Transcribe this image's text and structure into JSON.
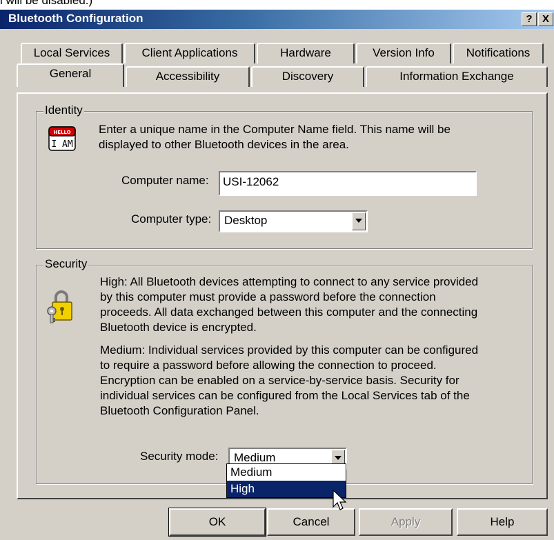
{
  "top_fragment": "l will be disabled.)",
  "window": {
    "title": "Bluetooth Configuration",
    "help_button": "?",
    "close_button": "X"
  },
  "tabs_row1": [
    "Local Services",
    "Client Applications",
    "Hardware",
    "Version Info",
    "Notifications"
  ],
  "tabs_row2": [
    "General",
    "Accessibility",
    "Discovery",
    "Information Exchange"
  ],
  "active_tab": "General",
  "identity": {
    "legend": "Identity",
    "icon": "hello-i-am-badge-icon",
    "badge_top": "HELLO",
    "badge_bottom": "I AM",
    "line1": "Enter a unique name in the Computer Name field. This name will be",
    "line2": "displayed to other Bluetooth devices in the area.",
    "computer_name_label": "Computer name:",
    "computer_name_value": "USI-12062",
    "computer_type_label": "Computer type:",
    "computer_type_value": "Desktop"
  },
  "security": {
    "legend": "Security",
    "icon": "padlock-keys-icon",
    "high_lines": [
      "High: All Bluetooth devices attempting to connect to any service provided",
      "by this computer must provide a password before the connection",
      "proceeds. All data exchanged between this computer and the connecting",
      "Bluetooth device is encrypted."
    ],
    "medium_lines": [
      "Medium: Individual services provided by this computer can be configured",
      "to require a password before allowing the connection to proceed.",
      "Encryption can be enabled on a service-by-service basis. Security for",
      "individual services can be configured from the Local Services tab of the",
      "Bluetooth Configuration Panel."
    ],
    "mode_label": "Security mode:",
    "mode_value": "Medium",
    "mode_options": [
      "Medium",
      "High"
    ],
    "highlighted_option": "High"
  },
  "buttons": {
    "ok": "OK",
    "cancel": "Cancel",
    "apply": "Apply",
    "help": "Help"
  },
  "colors": {
    "titlebar_start": "#0a246a",
    "titlebar_end": "#a6caf0",
    "face": "#d4d0c8",
    "selection": "#0a246a"
  }
}
